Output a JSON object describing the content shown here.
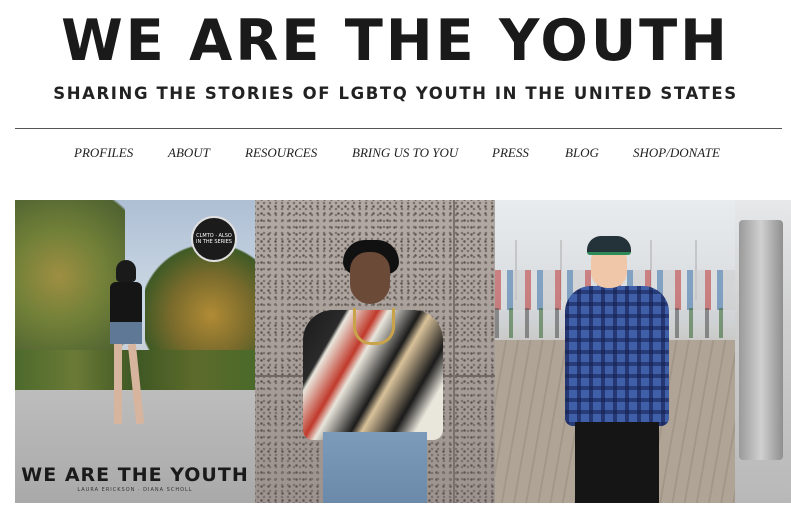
{
  "site": {
    "title": "WE ARE THE YOUTH",
    "tagline": "SHARING THE STORIES OF LGBTQ YOUTH IN THE UNITED STATES"
  },
  "nav": {
    "items": [
      {
        "label": "PROFILES"
      },
      {
        "label": "ABOUT"
      },
      {
        "label": "RESOURCES"
      },
      {
        "label": "BRING US TO YOU"
      },
      {
        "label": "PRESS"
      },
      {
        "label": "BLOG"
      },
      {
        "label": "SHOP/DONATE"
      }
    ]
  },
  "gallery": {
    "cards": [
      {
        "cover_title": "WE ARE THE YOUTH",
        "cover_authors": "LAURA ERICKSON · DIANA SCHOLL",
        "badge_text": "CLMTO · ALSO IN THE SERIES"
      },
      {},
      {},
      {}
    ]
  },
  "colors": {
    "text": "#1a1a1a",
    "rule": "#555555",
    "background": "#ffffff"
  }
}
